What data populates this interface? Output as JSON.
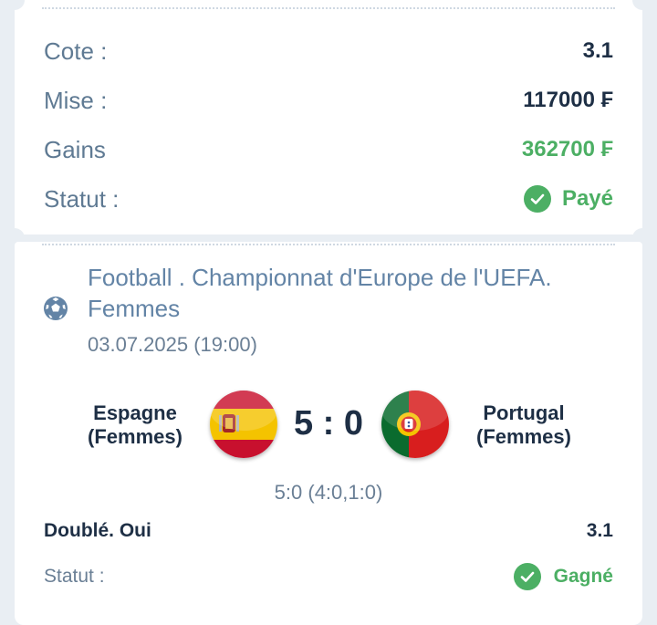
{
  "bet_summary": {
    "odds_label": "Cote :",
    "odds_value": "3.1",
    "stake_label": "Mise :",
    "stake_value": "117000 ₣",
    "winnings_label": "Gains",
    "winnings_value": "362700 ₣",
    "status_label": "Statut :",
    "status_value": "Payé"
  },
  "match": {
    "sport_icon": "soccer-ball-icon",
    "event_title": "Football . Championnat d'Europe de l'UEFA. Femmes",
    "datetime": "03.07.2025 (19:00)",
    "home_team": "Espagne (Femmes)",
    "away_team": "Portugal (Femmes)",
    "score": "5 : 0",
    "detailed_score": "5:0 (4:0,1:0)",
    "pick": "Doublé. Oui",
    "pick_odds": "3.1",
    "status_label": "Statut :",
    "status_value": "Gagné"
  },
  "colors": {
    "accent_green": "#4caf64",
    "title_blue": "#6384a6",
    "dark_text": "#1e2f45"
  }
}
